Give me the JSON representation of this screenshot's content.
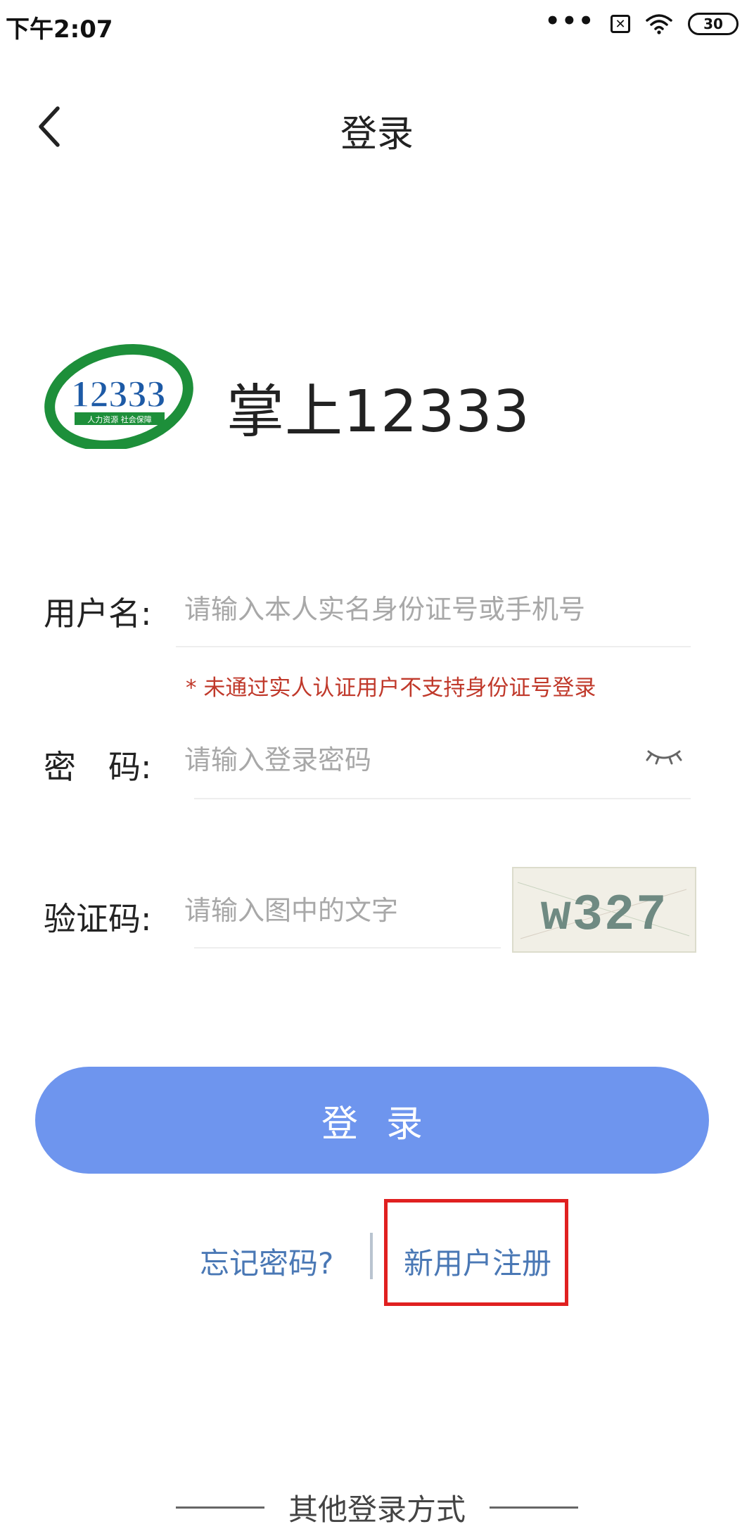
{
  "status_bar": {
    "time": "下午2:07",
    "signal_dots": "•••",
    "sim_icon": "✕",
    "battery": "30"
  },
  "nav": {
    "back_icon": "chevron-left-icon",
    "title": "登录"
  },
  "brand": {
    "logo_number": "12333",
    "logo_subtext": "人力资源 社会保障",
    "app_name": "掌上12333",
    "logo_colors": {
      "ring_green": "#1d8f3a",
      "number_blue": "#1d5aa6"
    }
  },
  "form": {
    "username": {
      "label": "用户名:",
      "placeholder": "请输入本人实名身份证号或手机号",
      "value": ""
    },
    "username_hint": "* 未通过实人认证用户不支持身份证号登录",
    "password": {
      "label": "密　码:",
      "placeholder": "请输入登录密码",
      "value": "",
      "toggle_icon": "eye-closed-icon"
    },
    "captcha": {
      "label": "验证码:",
      "placeholder": "请输入图中的文字",
      "value": "",
      "image_text": "w327"
    }
  },
  "actions": {
    "login_label": "登录",
    "forgot_password": "忘记密码?",
    "register": "新用户注册"
  },
  "footer": {
    "other_login": "其他登录方式"
  },
  "colors": {
    "primary": "#6e95ee",
    "link": "#4a78b5",
    "hint": "#c0392b",
    "highlight": "#e02020"
  }
}
